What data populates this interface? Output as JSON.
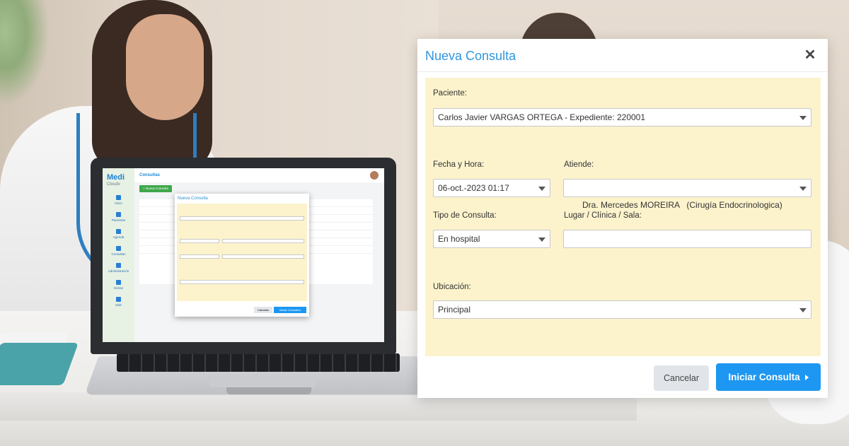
{
  "mini_app": {
    "logo_main": "Medi",
    "logo_sub": "Cloudv",
    "nav": [
      "Inicio",
      "Pacientes",
      "Agenda",
      "Consultas",
      "Administración",
      "Extras",
      "Salir"
    ],
    "header_title": "Consultas",
    "new_button": "+ Nueva Consulta",
    "modal_title": "Nueva Consulta",
    "cancel": "Cancelar",
    "start": "Iniciar Consulta ▸"
  },
  "modal": {
    "title": "Nueva Consulta",
    "close_label": "✕",
    "patient": {
      "label": "Paciente:",
      "value": "Carlos Javier VARGAS ORTEGA - Expediente: 220001"
    },
    "datetime": {
      "label": "Fecha y Hora:",
      "value": "06-oct.-2023 01:17"
    },
    "attends": {
      "label": "Atiende:",
      "value": "Dra. Mercedes MOREIRA   (Cirugía Endocrinologica)"
    },
    "consult_type": {
      "label": "Tipo de Consulta:",
      "value": "En hospital"
    },
    "place": {
      "label": "Lugar / Clínica / Sala:",
      "value": ""
    },
    "location": {
      "label": "Ubicación:",
      "value": "Principal"
    },
    "buttons": {
      "cancel": "Cancelar",
      "start": "Iniciar Consulta"
    }
  },
  "colors": {
    "accent": "#1d97f2",
    "title": "#2f96dd",
    "form_bg": "#fcf3cc"
  }
}
